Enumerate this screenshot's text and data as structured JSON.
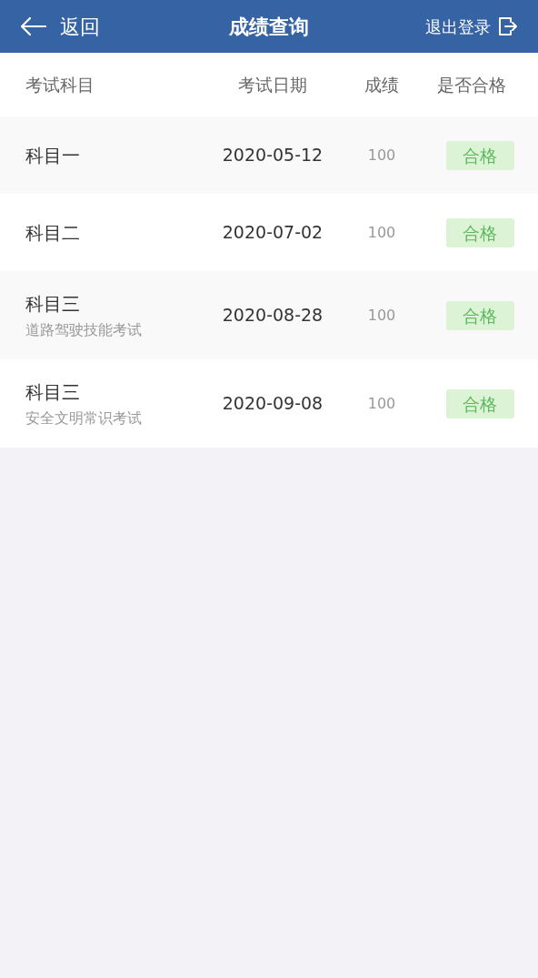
{
  "header": {
    "back": "返回",
    "title": "成绩查询",
    "logout": "退出登录"
  },
  "columns": [
    "考试科目",
    "考试日期",
    "成绩",
    "是否合格"
  ],
  "rows": [
    {
      "subject": "科目一",
      "date": "2020-05-12",
      "score": "100",
      "result": "合格",
      "passed": true
    },
    {
      "subject": "科目二",
      "date": "2020-07-02",
      "score": "100",
      "result": "合格",
      "passed": true
    },
    {
      "subject": "科目三",
      "detail": "道路驾驶技能考试",
      "date": "2020-08-28",
      "score": "100",
      "result": "合格",
      "passed": true
    },
    {
      "subject": "科目三",
      "detail": "安全文明常识考试",
      "date": "2020-09-08",
      "score": "100",
      "result": "合格",
      "passed": true
    }
  ]
}
